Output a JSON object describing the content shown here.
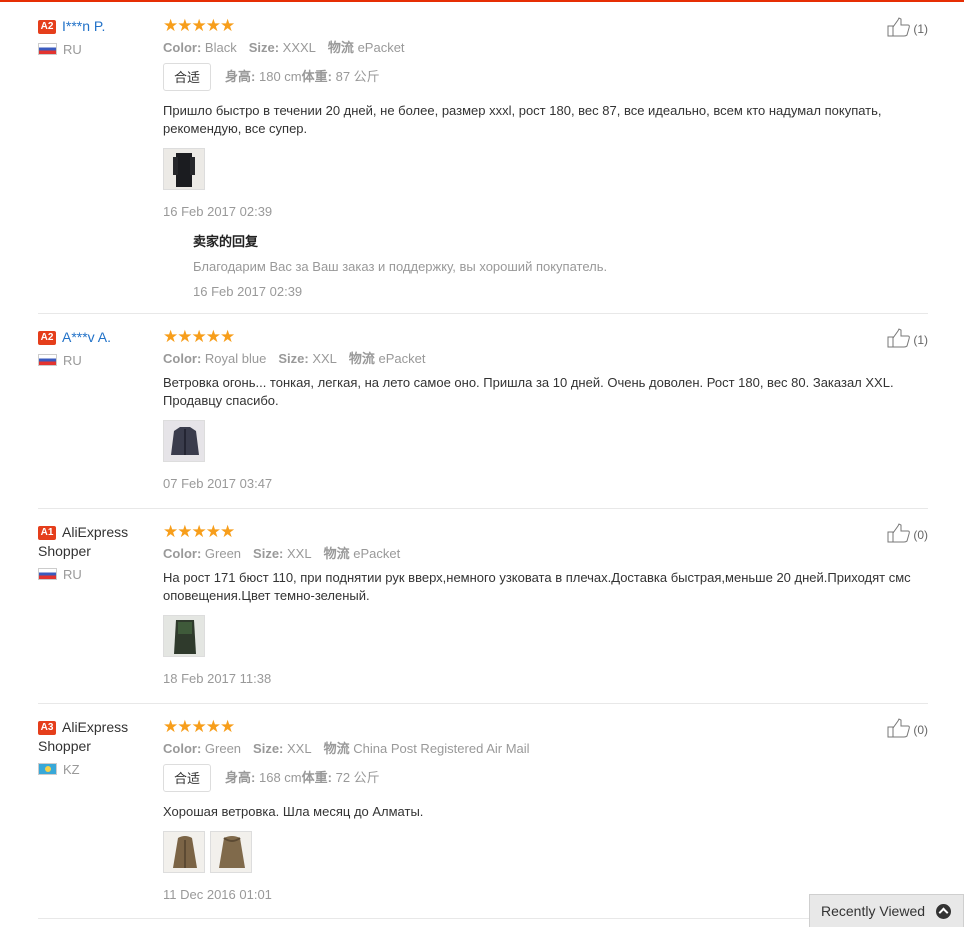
{
  "reviews": [
    {
      "level": "A2",
      "name": "I***n P.",
      "country": "RU",
      "stars": "★★★★★",
      "color_label": "Color:",
      "color": "Black",
      "size_label": "Size:",
      "size": "XXXL",
      "ship_label": "物流",
      "shipping": "ePacket",
      "fit_tag": "合适",
      "height_label": "身高:",
      "height": "180 cm",
      "weight_label": "体重:",
      "weight": "87 公斤",
      "text": "Пришло быстро в течении 20 дней, не более, размер xxxl, рост 180, вес 87, все идеально, всем кто надумал покупать, рекомендую, все супер.",
      "date": "16 Feb 2017 02:39",
      "reply_title": "卖家的回复",
      "reply_text": "Благодарим Вас за Ваш заказ и поддержку, вы хороший покупатель.",
      "reply_date": "16 Feb 2017 02:39",
      "helpful": "(1)"
    },
    {
      "level": "A2",
      "name": "A***v A.",
      "country": "RU",
      "stars": "★★★★★",
      "color_label": "Color:",
      "color": "Royal blue",
      "size_label": "Size:",
      "size": "XXL",
      "ship_label": "物流",
      "shipping": "ePacket",
      "text": "Ветровка огонь... тонкая, легкая, на лето самое оно. Пришла за 10 дней. Очень доволен. Рост 180, вес 80. Заказал XXL. Продавцу спасибо.",
      "date": "07 Feb 2017 03:47",
      "helpful": "(1)"
    },
    {
      "level": "A1",
      "name": "AliExpress Shopper",
      "country": "RU",
      "stars": "★★★★★",
      "color_label": "Color:",
      "color": "Green",
      "size_label": "Size:",
      "size": "XXL",
      "ship_label": "物流",
      "shipping": "ePacket",
      "text": "На рост 171 бюст 110, при поднятии рук вверх,немного узковата в плечах.Доставка быстрая,меньше 20 дней.Приходят смс оповещения.Цвет темно-зеленый.",
      "date": "18 Feb 2017 11:38",
      "helpful": "(0)"
    },
    {
      "level": "A3",
      "name": "AliExpress Shopper",
      "country": "KZ",
      "stars": "★★★★★",
      "color_label": "Color:",
      "color": "Green",
      "size_label": "Size:",
      "size": "XXL",
      "ship_label": "物流",
      "shipping": "China Post Registered Air Mail",
      "fit_tag": "合适",
      "height_label": "身高:",
      "height": "168 cm",
      "weight_label": "体重:",
      "weight": "72 公斤",
      "text": "Хорошая ветровка. Шла месяц до Алматы.",
      "date": "11 Dec 2016 01:01",
      "helpful": "(0)"
    }
  ],
  "recently_viewed": "Recently Viewed",
  "icons": {
    "helpful": "thumbs-up-icon",
    "recent": "chevron-up-icon"
  },
  "colors": {
    "accent": "#e62e04",
    "stars": "#f79e1b",
    "level_badge": "#e53e1b",
    "buyer_link": "#2272c8"
  }
}
